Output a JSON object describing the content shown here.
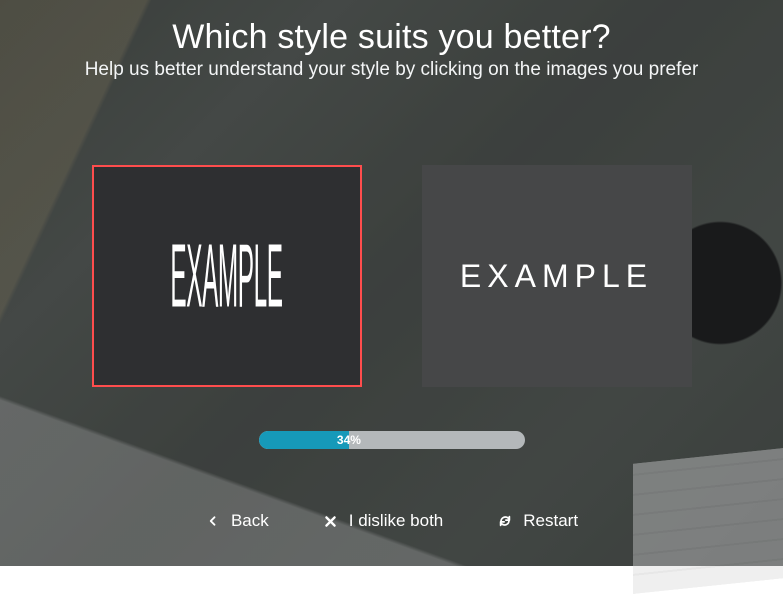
{
  "heading": "Which style suits you better?",
  "subheading": "Help us better understand your style by clicking on the images you prefer",
  "options": {
    "left": {
      "text": "EXAMPLE",
      "selected": true
    },
    "right": {
      "text": "EXAMPLE",
      "selected": false
    }
  },
  "progress": {
    "percent": 34,
    "label": "34%"
  },
  "actions": {
    "back": "Back",
    "dislike": "I dislike both",
    "restart": "Restart"
  }
}
